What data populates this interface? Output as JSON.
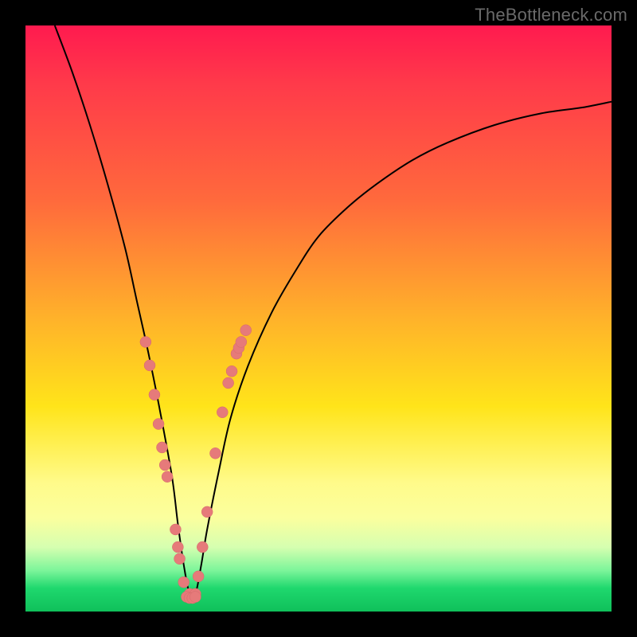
{
  "watermark": "TheBottleneck.com",
  "colors": {
    "frame": "#000000",
    "curve_stroke": "#000000",
    "dot_fill": "#e67a7a",
    "dot_stroke": "#d46a6a"
  },
  "chart_data": {
    "type": "line",
    "title": "",
    "xlabel": "",
    "ylabel": "",
    "xlim": [
      0,
      100
    ],
    "ylim": [
      0,
      100
    ],
    "grid": false,
    "legend": false,
    "optimum_x": 28,
    "series": [
      {
        "name": "bottleneck-curve",
        "x": [
          5,
          8,
          11,
          14,
          17,
          19,
          21,
          23,
          25,
          26,
          27,
          28,
          29,
          30,
          31,
          33,
          35,
          38,
          42,
          46,
          50,
          55,
          60,
          66,
          72,
          80,
          88,
          95,
          100
        ],
        "values": [
          100,
          92,
          83,
          73,
          62,
          53,
          44,
          34,
          23,
          15,
          8,
          3,
          3,
          8,
          14,
          24,
          33,
          42,
          51,
          58,
          64,
          69,
          73,
          77,
          80,
          83,
          85,
          86,
          87
        ]
      }
    ],
    "dots_left": {
      "name": "points-left-branch",
      "x": [
        20.5,
        21.2,
        22.0,
        22.7,
        23.3,
        23.8,
        24.2,
        25.6,
        26.0,
        26.3,
        27.0,
        28.0
      ],
      "values": [
        46,
        42,
        37,
        32,
        28,
        25,
        23,
        14,
        11,
        9,
        5,
        3
      ]
    },
    "dots_right": {
      "name": "points-right-branch",
      "x": [
        29.0,
        29.5,
        30.2,
        31.0,
        32.4,
        33.6,
        34.6,
        35.2,
        36.0,
        36.4,
        36.8,
        37.6
      ],
      "values": [
        3,
        6,
        11,
        17,
        27,
        34,
        39,
        41,
        44,
        45,
        46,
        48
      ]
    },
    "dots_bottom": {
      "name": "points-flat-bottom",
      "x": [
        27.5,
        28.0,
        28.5,
        29.0
      ],
      "values": [
        2.5,
        2.3,
        2.3,
        2.5
      ]
    }
  }
}
